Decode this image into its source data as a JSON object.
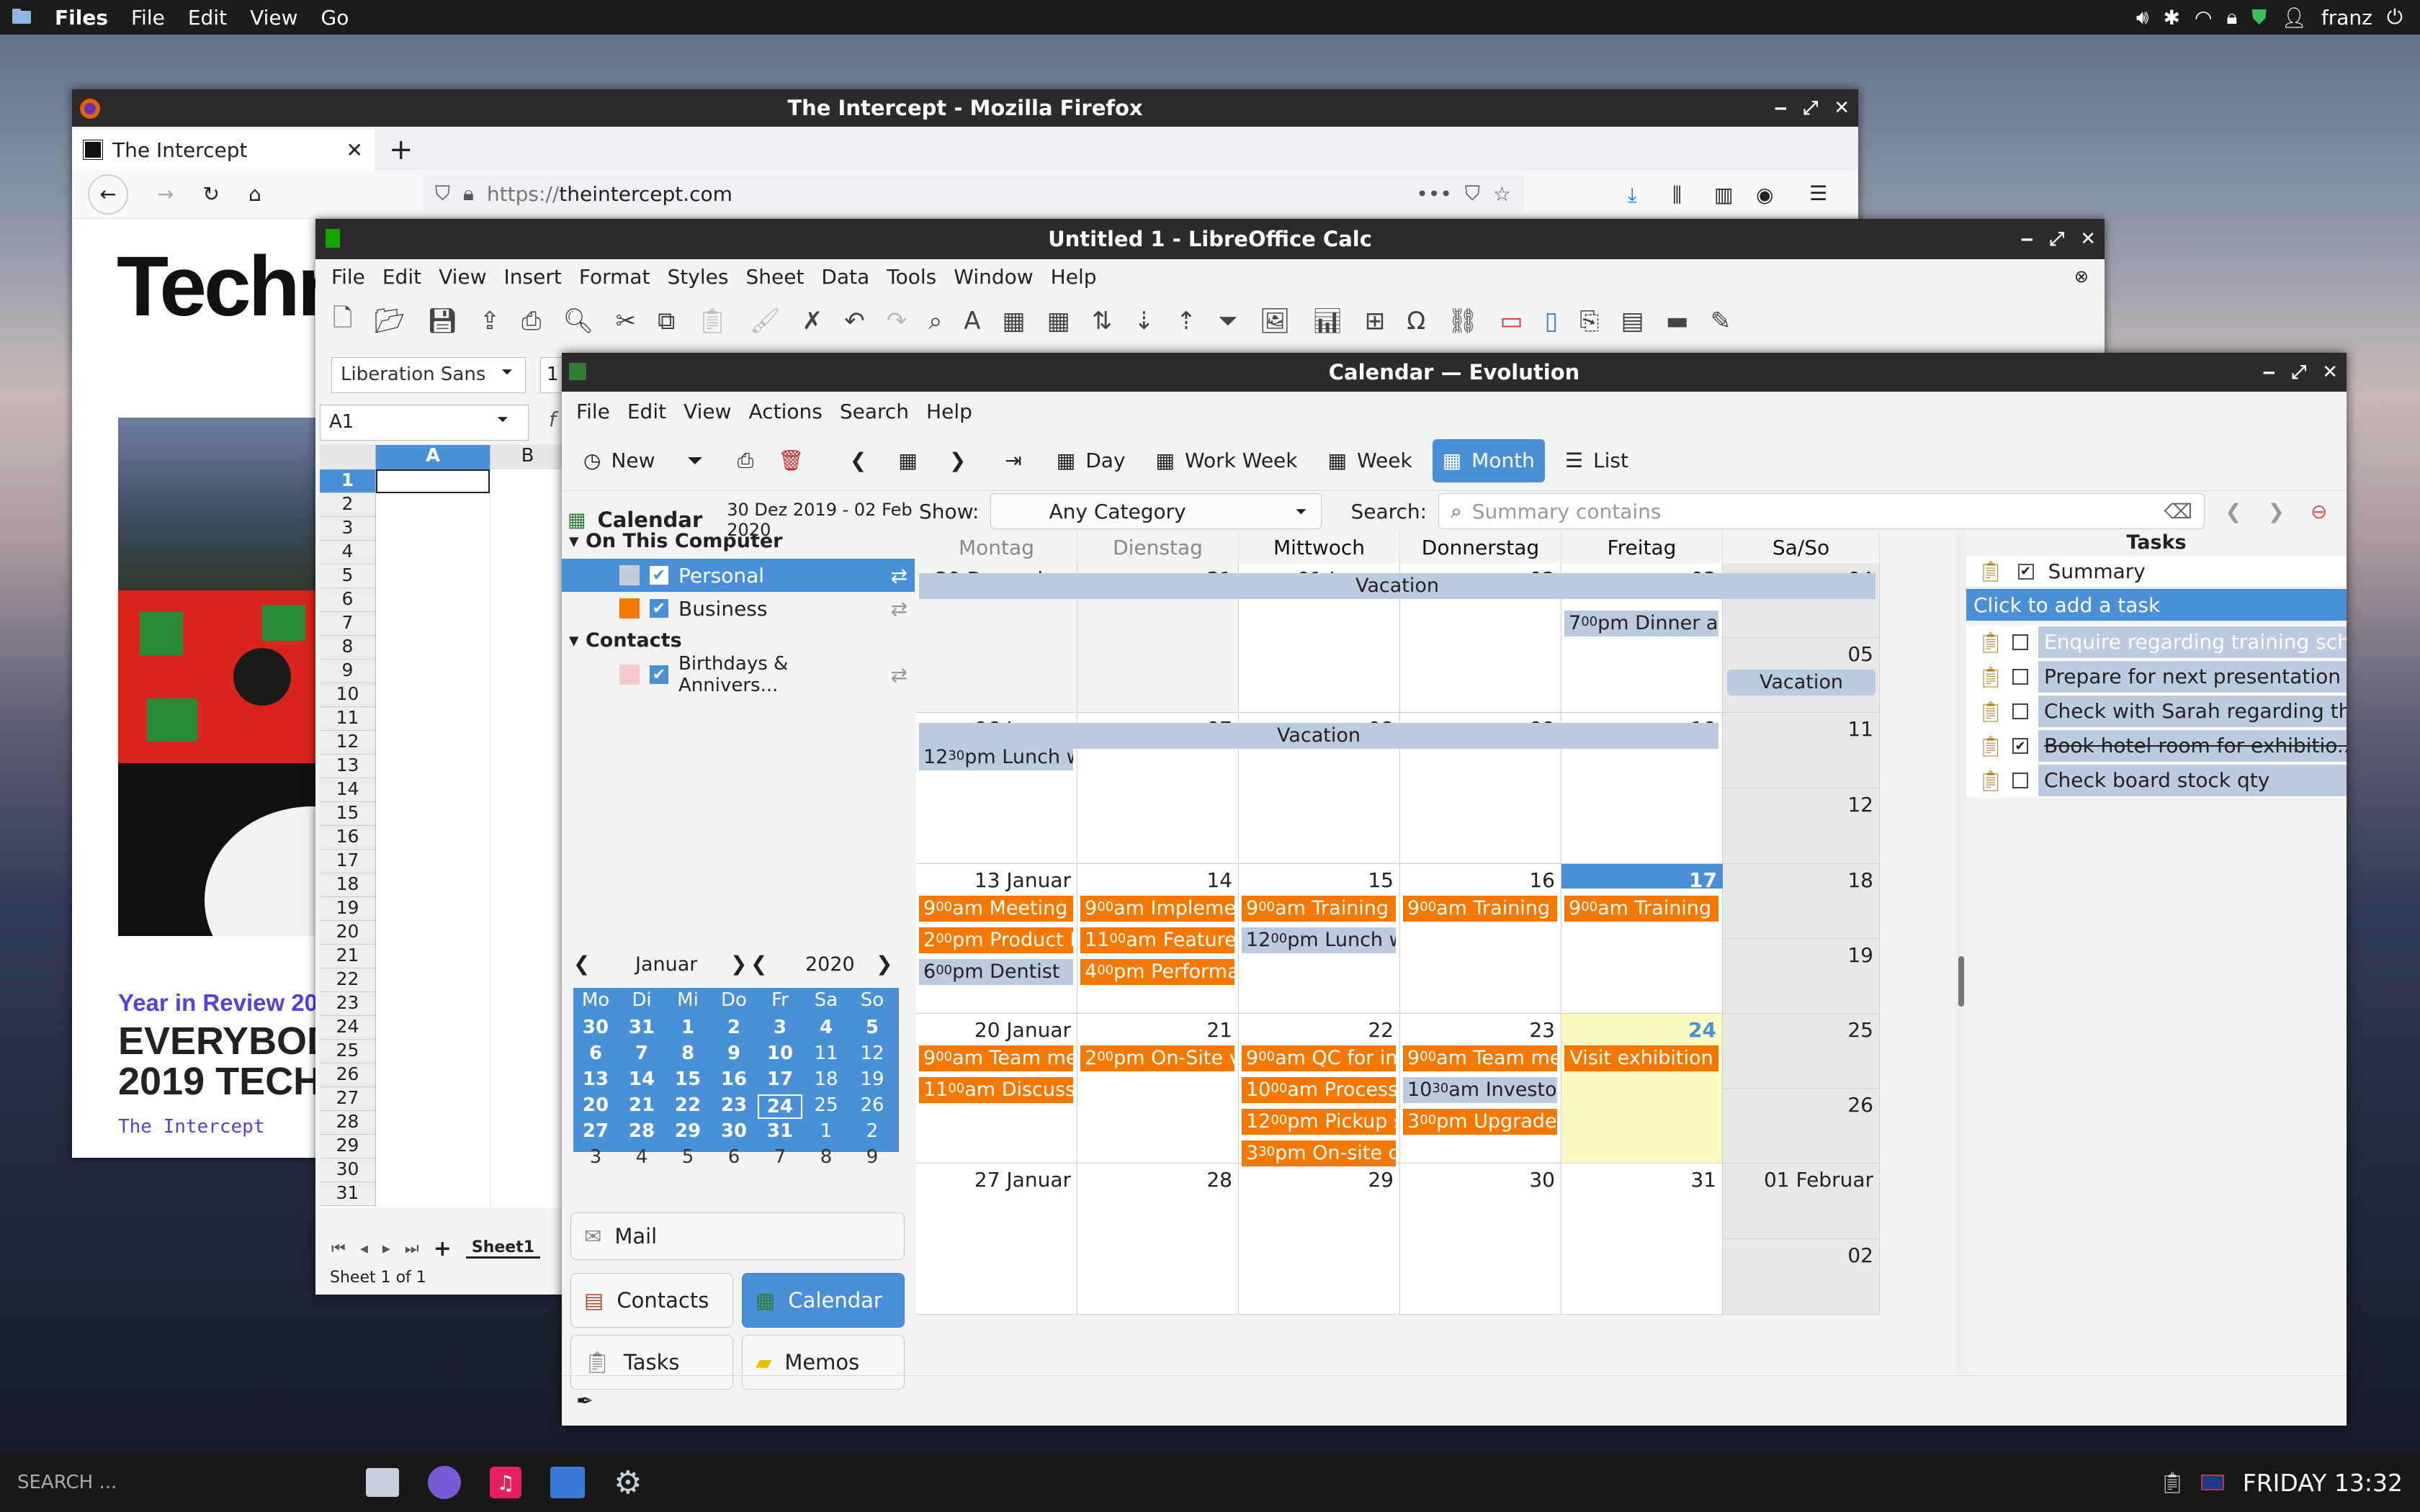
{
  "top_panel": {
    "menus": [
      "Files",
      "File",
      "Edit",
      "View",
      "Go"
    ],
    "user": "franz"
  },
  "firefox": {
    "title": "The Intercept - Mozilla Firefox",
    "tab_title": "The Intercept",
    "url_scheme": "https://",
    "url_host": "theintercept.com",
    "page": {
      "headline": "Techn",
      "label": "Year in Review 20",
      "big_title_line1": "EVERYBOD",
      "big_title_line2": "2019 TECH",
      "byline": "The Intercept"
    }
  },
  "calc": {
    "title": "Untitled 1 - LibreOffice Calc",
    "menus": [
      "File",
      "Edit",
      "View",
      "Insert",
      "Format",
      "Styles",
      "Sheet",
      "Data",
      "Tools",
      "Window",
      "Help"
    ],
    "font_name": "Liberation Sans",
    "font_size": "1",
    "name_box": "A1",
    "formula_fx": "f",
    "col_a": "A",
    "col_b": "B",
    "rows": [
      "1",
      "2",
      "3",
      "4",
      "5",
      "6",
      "7",
      "8",
      "9",
      "10",
      "11",
      "12",
      "13",
      "14",
      "15",
      "16",
      "17",
      "18",
      "19",
      "20",
      "21",
      "22",
      "23",
      "24",
      "25",
      "26",
      "27",
      "28",
      "29",
      "30",
      "31"
    ],
    "sheet_tab": "Sheet1",
    "status": "Sheet 1 of 1"
  },
  "evolution": {
    "title": "Calendar — Evolution",
    "menus": [
      "File",
      "Edit",
      "View",
      "Actions",
      "Search",
      "Help"
    ],
    "toolbar": {
      "new": "New",
      "day": "Day",
      "work_week": "Work Week",
      "week": "Week",
      "month": "Month",
      "list": "List"
    },
    "sidebar": {
      "header": "Calendar",
      "range": "30 Dez 2019 - 02 Feb 2020",
      "group1": "On This Computer",
      "personal": "Personal",
      "business": "Business",
      "group2": "Contacts",
      "birthdays": "Birthdays & Annivers..."
    },
    "filter": {
      "show_label": "Show:",
      "category": "Any Category",
      "search_label": "Search:",
      "search_placeholder": "Summary contains"
    },
    "weekdays": [
      "Montag",
      "Dienstag",
      "Mittwoch",
      "Donnerstag",
      "Freitag",
      "Sa/So"
    ],
    "days": [
      [
        "30 Dezember",
        "31",
        "01 Januar",
        "02",
        "03",
        "04",
        "05"
      ],
      [
        "06 Januar",
        "07",
        "08",
        "09",
        "10",
        "11",
        "12"
      ],
      [
        "13 Januar",
        "14",
        "15",
        "16",
        "17",
        "18",
        "19"
      ],
      [
        "20 Januar",
        "21",
        "22",
        "23",
        "24",
        "25",
        "26"
      ],
      [
        "27 Januar",
        "28",
        "29",
        "30",
        "31",
        "01 Februar",
        "02"
      ]
    ],
    "events": {
      "vacation": "Vacation",
      "dinner": "pm Dinner at",
      "dinner_h": "7",
      "lunch1": "pm Lunch wit",
      "lunch1_h": "12",
      "meeting": "am Meeting w",
      "meeting_h": "9",
      "product": "pm Product D",
      "product_h": "2",
      "dentist": "pm Dentist",
      "dentist_h": "6",
      "implement": "am Implemen",
      "implement_h": "9",
      "feature": "am Feature D",
      "feature_h": "11",
      "perform": "pm Performa",
      "perform_h": "4",
      "training": "am Training",
      "training_h": "9",
      "lunch2": "pm Lunch wit",
      "lunch2_h": "12",
      "team1": "am Team me",
      "team1_h": "9",
      "discuss": "am Discussio",
      "discuss_h": "11",
      "onsite": "pm On-Site v",
      "onsite_h": "2",
      "qc": "am QC for ini",
      "qc_h": "9",
      "process": "am Processin",
      "process_h": "10",
      "pickup": "pm Pickup sh",
      "pickup_h": "12",
      "onsite2": "pm On-site d",
      "onsite2_h": "3",
      "team2": "am Team me",
      "team2_h": "9",
      "investor": "am Investor p",
      "investor_h": "10",
      "upgrade": "pm Upgrade f",
      "upgrade_h": "3",
      "visit": "Visit exhibition",
      "min00": "00",
      "min30": "30"
    },
    "minical": {
      "month": "Januar",
      "year": "2020",
      "heads": [
        "Mo",
        "Di",
        "Mi",
        "Do",
        "Fr",
        "Sa",
        "So"
      ],
      "weeks": [
        [
          "30",
          "31",
          "1",
          "2",
          "3",
          "4",
          "5"
        ],
        [
          "6",
          "7",
          "8",
          "9",
          "10",
          "11",
          "12"
        ],
        [
          "13",
          "14",
          "15",
          "16",
          "17",
          "18",
          "19"
        ],
        [
          "20",
          "21",
          "22",
          "23",
          "24",
          "25",
          "26"
        ],
        [
          "27",
          "28",
          "29",
          "30",
          "31",
          "1",
          "2"
        ],
        [
          "3",
          "4",
          "5",
          "6",
          "7",
          "8",
          "9"
        ]
      ]
    },
    "nav": {
      "mail": "Mail",
      "contacts": "Contacts",
      "calendar": "Calendar",
      "tasks": "Tasks",
      "memos": "Memos"
    },
    "tasks": {
      "header": "Tasks",
      "summary": "Summary",
      "add": "Click to add a task",
      "items": [
        {
          "text": "Enquire regarding training sch...",
          "done": false
        },
        {
          "text": "Prepare for next presentation",
          "done": false
        },
        {
          "text": "Check with Sarah regarding th...",
          "done": false
        },
        {
          "text": "Book hotel room for exhibitio...",
          "done": true
        },
        {
          "text": "Check board stock qty",
          "done": false
        }
      ]
    }
  },
  "taskbar": {
    "search": "SEARCH ...",
    "clock": "FRIDAY 13:32"
  },
  "colors": {
    "accent": "#4a90d9",
    "event_orange": "#f57900",
    "event_blue": "#bccbde",
    "today": "#fdf9c2"
  }
}
